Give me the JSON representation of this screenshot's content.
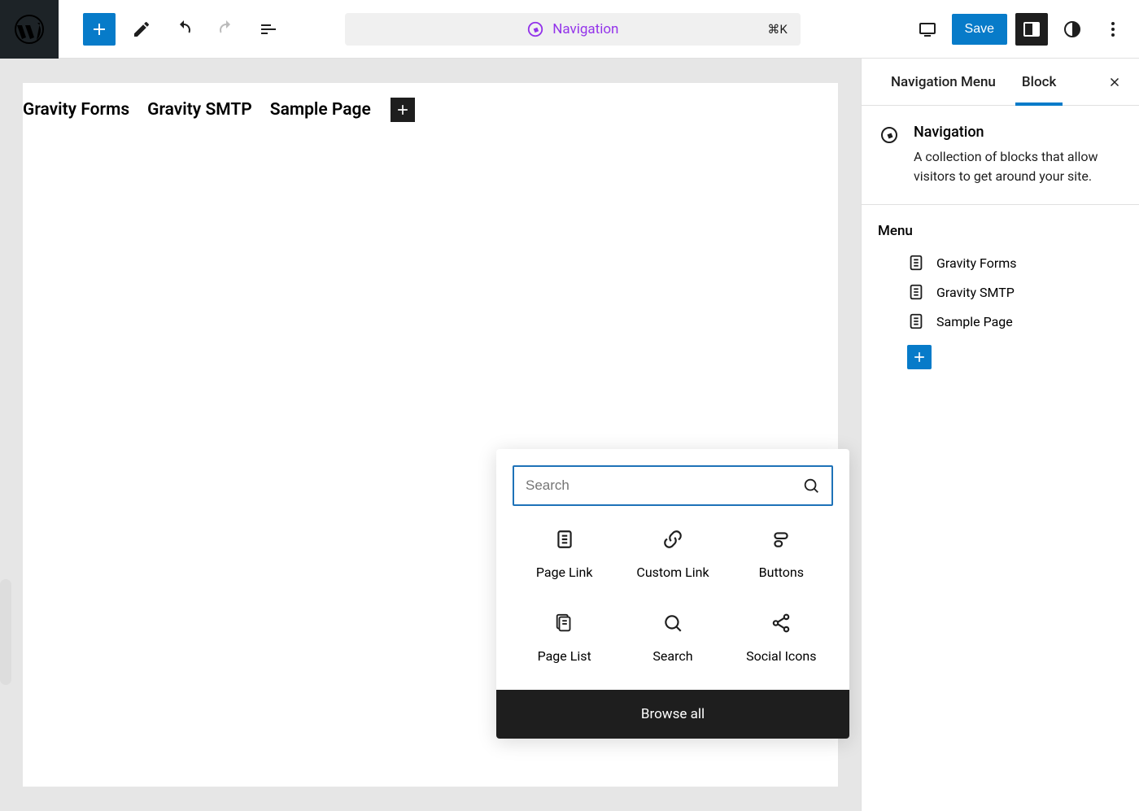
{
  "toolbar": {
    "doc_title": "Navigation",
    "kbd": "⌘K",
    "save_label": "Save"
  },
  "nav_items": [
    "Gravity Forms",
    "Gravity SMTP",
    "Sample Page"
  ],
  "sidebar": {
    "tabs": [
      "Navigation Menu",
      "Block"
    ],
    "active_tab": 1,
    "block_name": "Navigation",
    "block_desc": "A collection of blocks that allow visitors to get around your site.",
    "menu_heading": "Menu",
    "menu_items": [
      "Gravity Forms",
      "Gravity SMTP",
      "Sample Page"
    ]
  },
  "inserter": {
    "search_placeholder": "Search",
    "blocks": [
      "Page Link",
      "Custom Link",
      "Buttons",
      "Page List",
      "Search",
      "Social Icons"
    ],
    "browse_all": "Browse all"
  },
  "colors": {
    "accent": "#077bc9",
    "purple": "#9333ea",
    "dark": "#1e1e1e"
  }
}
